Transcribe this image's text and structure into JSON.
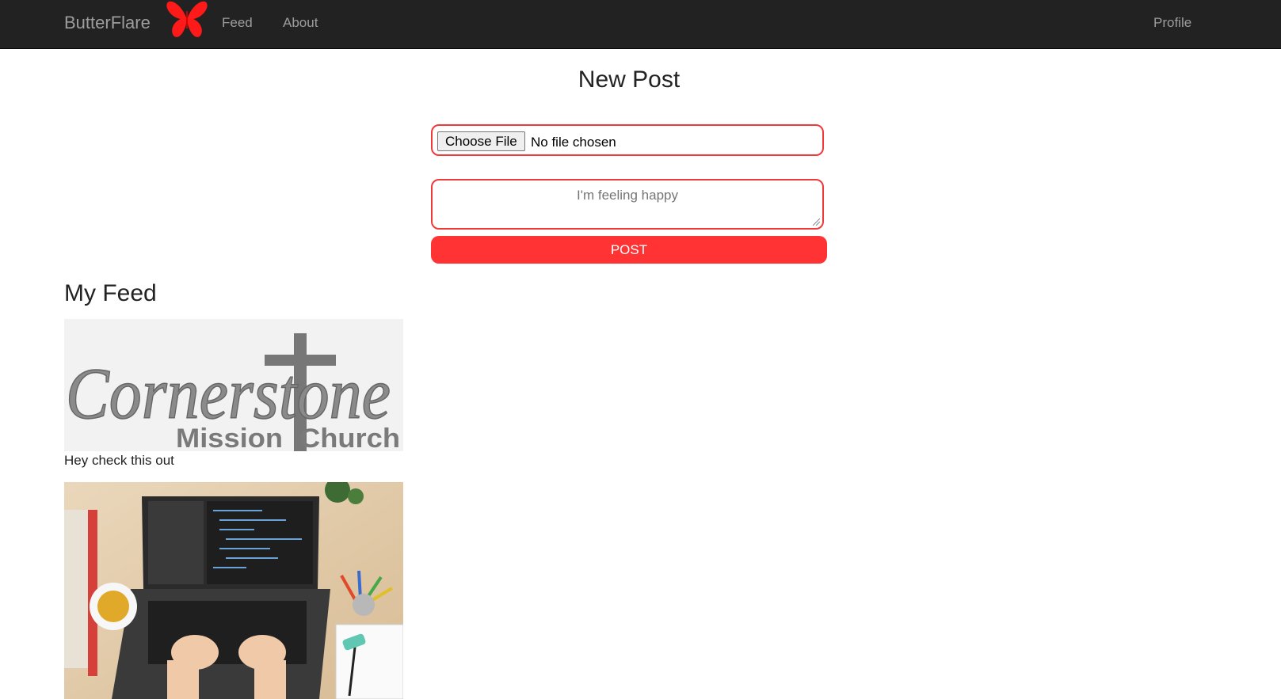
{
  "navbar": {
    "brand": "ButterFlare",
    "links": [
      "Feed",
      "About"
    ],
    "profile": "Profile",
    "bg_color": "#222222",
    "logo_color": "#ff1a1a"
  },
  "new_post": {
    "title": "New Post",
    "file_button": "Choose File",
    "file_status": "No file chosen",
    "text_placeholder": "I'm feeling happy",
    "post_button": "POST",
    "accent": "#ff3333"
  },
  "feed": {
    "title": "My Feed",
    "posts": [
      {
        "image": {
          "word": "Cornerstone",
          "line2a": "Mission",
          "line2b": "Church",
          "icon": "cross-icon"
        },
        "caption": "Hey check this out"
      },
      {
        "image": {
          "description_icon": "laptop-desk-photo"
        }
      }
    ]
  }
}
